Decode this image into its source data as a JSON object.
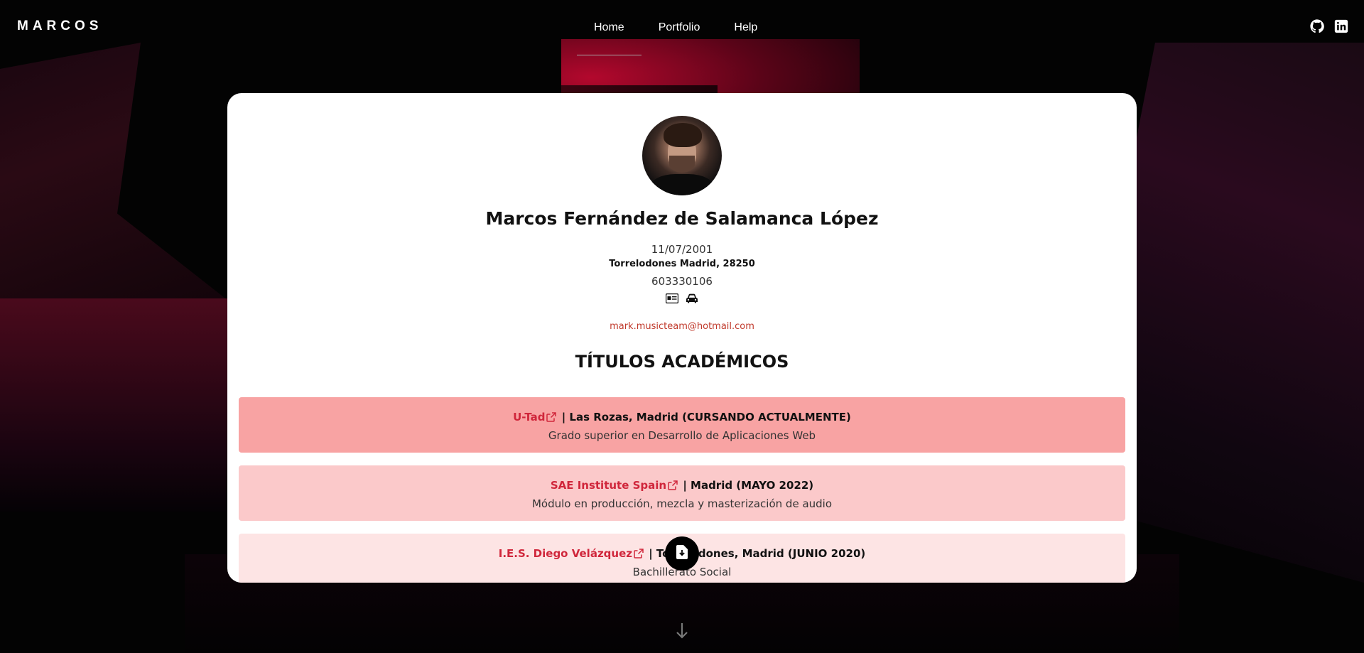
{
  "nav": {
    "brand": "MARCOS",
    "items": [
      {
        "label": "Home",
        "active": true
      },
      {
        "label": "Portfolio",
        "active": false
      },
      {
        "label": "Help",
        "active": false
      }
    ],
    "social_icons": [
      "github-icon",
      "linkedin-icon"
    ]
  },
  "profile": {
    "name": "Marcos Fernández de Salamanca López",
    "birthdate": "11/07/2001",
    "address": "Torrelodones Madrid, 28250",
    "phone": "603330106",
    "badges": [
      "id-card-icon",
      "car-icon"
    ],
    "email": "mark.musicteam@hotmail.com"
  },
  "education": {
    "title": "TÍTULOS ACADÉMICOS",
    "items": [
      {
        "institution": "U-Tad",
        "location": " | Las Rozas, Madrid (CURSANDO ACTUALMENTE)",
        "degree": "Grado superior en Desarrollo de Aplicaciones Web"
      },
      {
        "institution": "SAE Institute Spain",
        "location": " | Madrid (MAYO 2022)",
        "degree": "Módulo en producción, mezcla y masterización de audio"
      },
      {
        "institution": "I.E.S. Diego Velázquez",
        "location": " | Torrelodones, Madrid (JUNIO 2020)",
        "degree": "Bachillerato Social"
      }
    ]
  },
  "colors": {
    "accent": "#d0263b",
    "row1": "#f8a3a3",
    "row2": "#fbc9ca",
    "row3": "#fde4e4"
  },
  "actions": {
    "download_icon": "download-file-icon",
    "scroll_icon": "arrow-down-icon"
  }
}
